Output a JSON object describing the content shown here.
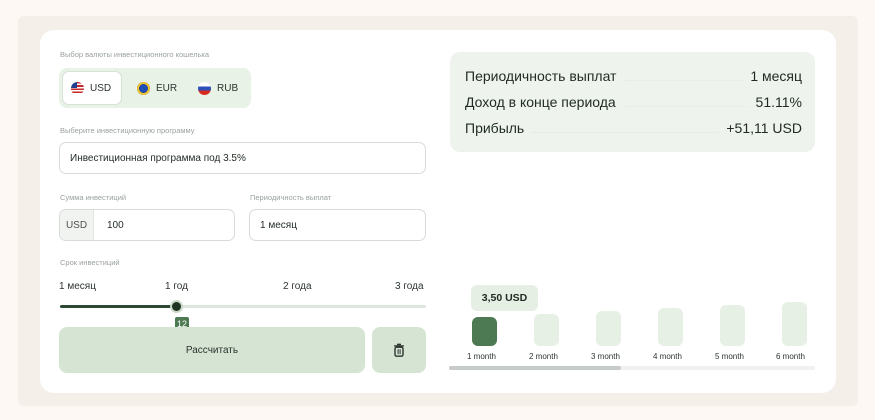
{
  "currency": {
    "label": "Выбор валюты инвестиционного кошелька",
    "options": [
      {
        "label": "USD",
        "icon": "us-flag-icon",
        "active": true
      },
      {
        "label": "EUR",
        "icon": "eu-flag-icon",
        "active": false
      },
      {
        "label": "RUB",
        "icon": "ru-flag-icon",
        "active": false
      }
    ]
  },
  "program": {
    "label": "Выберите инвестиционную программу",
    "value": "Инвестиционная программа под 3.5%"
  },
  "amount": {
    "label": "Сумма инвестиций",
    "prefix": "USD",
    "value": "100"
  },
  "payout": {
    "label": "Периодичность выплат",
    "value": "1 месяц"
  },
  "term": {
    "label": "Срок инвестиций",
    "ticks": [
      "1 месяц",
      "1 год",
      "2 года",
      "3 года"
    ],
    "value": "12"
  },
  "actions": {
    "calculate_label": "Рассчитать",
    "delete_icon": "trash-icon"
  },
  "summary": {
    "rows": [
      {
        "label": "Периодичность выплат",
        "value": "1 месяц"
      },
      {
        "label": "Доход в конце периода",
        "value": "51.11%"
      },
      {
        "label": "Прибыль",
        "value": "+51,11 USD"
      }
    ]
  },
  "chart": {
    "tooltip": "3,50 USD",
    "months": [
      "1 month",
      "2 month",
      "3 month",
      "4 month",
      "5 month",
      "6 month"
    ]
  },
  "colors": {
    "accent": "#4d7a52",
    "accent_light": "#d6e4d4",
    "background": "#fdf8f3"
  }
}
